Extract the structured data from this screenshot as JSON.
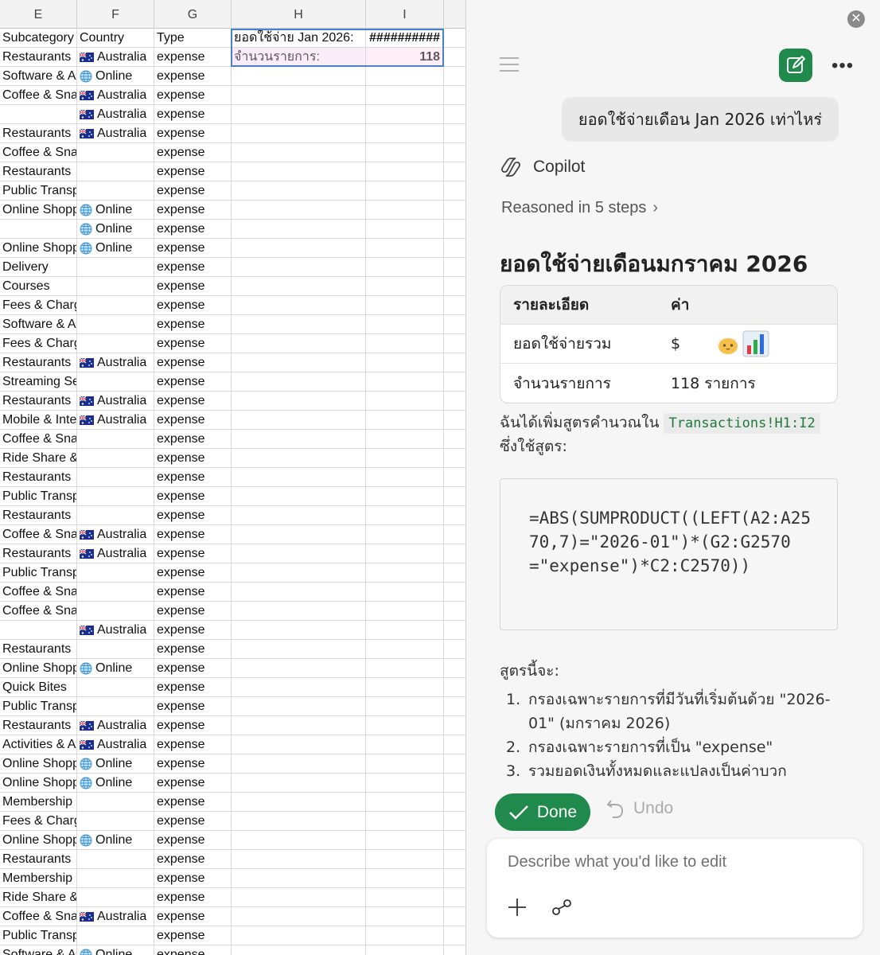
{
  "sheet": {
    "columns": [
      "E",
      "F",
      "G",
      "H",
      "I"
    ],
    "header_row": {
      "e": "Subcategory",
      "f": "Country",
      "g": "Type"
    },
    "summary_cells": {
      "h1": "ยอดใช้จ่าย Jan 2026:",
      "i1": "##########",
      "h2": "จำนวนรายการ:",
      "i2": "118"
    },
    "rows": [
      {
        "e": "Restaurants",
        "country_icon": "flag-australia-icon",
        "f": "Australia",
        "g": "expense"
      },
      {
        "e": "Software & Apps",
        "country_icon": "globe-icon",
        "f": "Online",
        "g": "expense"
      },
      {
        "e": "Coffee & Snacks",
        "country_icon": "flag-australia-icon",
        "f": "Australia",
        "g": "expense"
      },
      {
        "e": "",
        "country_icon": "flag-australia-icon",
        "f": "Australia",
        "g": "expense"
      },
      {
        "e": "Restaurants",
        "country_icon": "flag-australia-icon",
        "f": "Australia",
        "g": "expense"
      },
      {
        "e": "Coffee & Snacks",
        "country_icon": "",
        "f": "",
        "g": "expense"
      },
      {
        "e": "Restaurants",
        "country_icon": "",
        "f": "",
        "g": "expense"
      },
      {
        "e": "Public Transport",
        "country_icon": "",
        "f": "",
        "g": "expense"
      },
      {
        "e": "Online Shopping",
        "country_icon": "globe-icon",
        "f": "Online",
        "g": "expense"
      },
      {
        "e": "",
        "country_icon": "globe-icon",
        "f": "Online",
        "g": "expense"
      },
      {
        "e": "Online Shopping",
        "country_icon": "globe-icon",
        "f": "Online",
        "g": "expense"
      },
      {
        "e": "Delivery",
        "country_icon": "",
        "f": "",
        "g": "expense"
      },
      {
        "e": "Courses",
        "country_icon": "",
        "f": "",
        "g": "expense"
      },
      {
        "e": "Fees & Charges",
        "country_icon": "",
        "f": "",
        "g": "expense"
      },
      {
        "e": "Software & Apps",
        "country_icon": "",
        "f": "",
        "g": "expense"
      },
      {
        "e": "Fees & Charges",
        "country_icon": "",
        "f": "",
        "g": "expense"
      },
      {
        "e": "Restaurants",
        "country_icon": "flag-australia-icon",
        "f": "Australia",
        "g": "expense"
      },
      {
        "e": "Streaming Services",
        "country_icon": "",
        "f": "",
        "g": "expense"
      },
      {
        "e": "Restaurants",
        "country_icon": "flag-australia-icon",
        "f": "Australia",
        "g": "expense"
      },
      {
        "e": "Mobile & Internet",
        "country_icon": "flag-australia-icon",
        "f": "Australia",
        "g": "expense"
      },
      {
        "e": "Coffee & Snacks",
        "country_icon": "",
        "f": "",
        "g": "expense"
      },
      {
        "e": "Ride Share & Taxi",
        "country_icon": "",
        "f": "",
        "g": "expense"
      },
      {
        "e": "Restaurants",
        "country_icon": "",
        "f": "",
        "g": "expense"
      },
      {
        "e": "Public Transport",
        "country_icon": "",
        "f": "",
        "g": "expense"
      },
      {
        "e": "Restaurants",
        "country_icon": "",
        "f": "",
        "g": "expense"
      },
      {
        "e": "Coffee & Snacks",
        "country_icon": "flag-australia-icon",
        "f": "Australia",
        "g": "expense"
      },
      {
        "e": "Restaurants",
        "country_icon": "flag-australia-icon",
        "f": "Australia",
        "g": "expense"
      },
      {
        "e": "Public Transport",
        "country_icon": "",
        "f": "",
        "g": "expense"
      },
      {
        "e": "Coffee & Snacks",
        "country_icon": "",
        "f": "",
        "g": "expense"
      },
      {
        "e": "Coffee & Snacks",
        "country_icon": "",
        "f": "",
        "g": "expense"
      },
      {
        "e": "",
        "country_icon": "flag-australia-icon",
        "f": "Australia",
        "g": "expense"
      },
      {
        "e": "Restaurants",
        "country_icon": "",
        "f": "",
        "g": "expense"
      },
      {
        "e": "Online Shopping",
        "country_icon": "globe-icon",
        "f": "Online",
        "g": "expense"
      },
      {
        "e": "Quick Bites",
        "country_icon": "",
        "f": "",
        "g": "expense"
      },
      {
        "e": "Public Transport",
        "country_icon": "",
        "f": "",
        "g": "expense"
      },
      {
        "e": "Restaurants",
        "country_icon": "flag-australia-icon",
        "f": "Australia",
        "g": "expense"
      },
      {
        "e": "Activities & Attractions",
        "country_icon": "flag-australia-icon",
        "f": "Australia",
        "g": "expense"
      },
      {
        "e": "Online Shopping",
        "country_icon": "globe-icon",
        "f": "Online",
        "g": "expense"
      },
      {
        "e": "Online Shopping",
        "country_icon": "globe-icon",
        "f": "Online",
        "g": "expense"
      },
      {
        "e": "Membership",
        "country_icon": "",
        "f": "",
        "g": "expense"
      },
      {
        "e": "Fees & Charges",
        "country_icon": "",
        "f": "",
        "g": "expense"
      },
      {
        "e": "Online Shopping",
        "country_icon": "globe-icon",
        "f": "Online",
        "g": "expense"
      },
      {
        "e": "Restaurants",
        "country_icon": "",
        "f": "",
        "g": "expense"
      },
      {
        "e": "Membership",
        "country_icon": "",
        "f": "",
        "g": "expense"
      },
      {
        "e": "Ride Share & Taxi",
        "country_icon": "",
        "f": "",
        "g": "expense"
      },
      {
        "e": "Coffee & Snacks",
        "country_icon": "flag-australia-icon",
        "f": "Australia",
        "g": "expense"
      },
      {
        "e": "Public Transport",
        "country_icon": "",
        "f": "",
        "g": "expense"
      },
      {
        "e": "Software & Apps",
        "country_icon": "globe-icon",
        "f": "Online",
        "g": "expense"
      }
    ]
  },
  "copilot": {
    "user_message": "ยอดใช้จ่ายเดือน Jan 2026 เท่าไหร่",
    "assistant_name": "Copilot",
    "reasoned_label": "Reasoned in 5 steps",
    "answer_title": "ยอดใช้จ่ายเดือนมกราคม 2026",
    "table": {
      "headers": [
        "รายละเอียด",
        "ค่า"
      ],
      "rows": [
        {
          "label": "ยอดใช้จ่ายรวม",
          "value": "$"
        },
        {
          "label": "จำนวนรายการ",
          "value": "118 รายการ"
        }
      ]
    },
    "intro_text": "ฉันได้เพิ่มสูตรคำนวณใน",
    "range_ref": "Transactions!H1:I2",
    "intro_text_2": "ซึ่งใช้สูตร:",
    "formula": "=ABS(SUMPRODUCT((LEFT(A2:A2570,7)=\"2026-01\")*(G2:G2570=\"expense\")*C2:C2570))",
    "explain_title": "สูตรนี้จะ:",
    "steps": [
      "กรองเฉพาะรายการที่มีวันที่เริ่มต้นด้วย \"2026-01\" (มกราคม 2026)",
      "กรองเฉพาะรายการที่เป็น \"expense\"",
      "รวมยอดเงินทั้งหมดและแปลงเป็นค่าบวก"
    ],
    "done_label": "Done",
    "undo_label": "Undo",
    "composer_placeholder": "Describe what you'd like to edit",
    "colors": {
      "accent": "#1f8a4c",
      "range_ref": "#1f7a3a"
    }
  }
}
